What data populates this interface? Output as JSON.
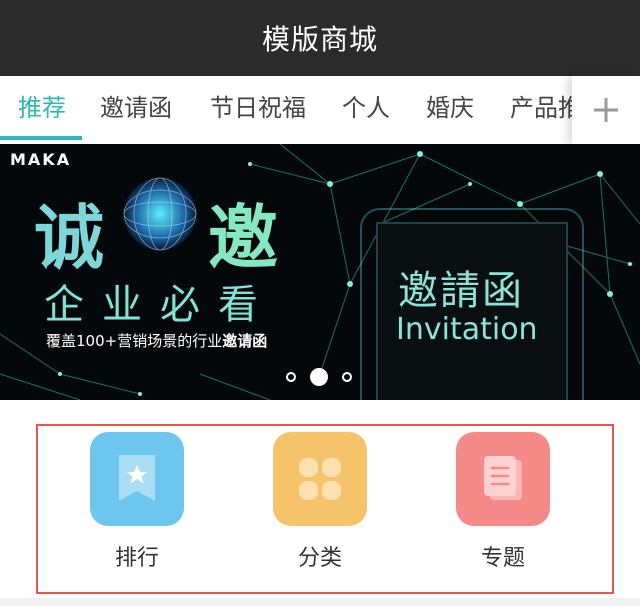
{
  "header": {
    "title": "模版商城"
  },
  "tabs": [
    {
      "label": "推荐",
      "active": true
    },
    {
      "label": "邀请函",
      "active": false
    },
    {
      "label": "节日祝福",
      "active": false
    },
    {
      "label": "个人",
      "active": false
    },
    {
      "label": "婚庆",
      "active": false
    },
    {
      "label": "产品推",
      "active": false
    }
  ],
  "tabs_add_icon": "plus-icon",
  "banner": {
    "logo": "MAKA",
    "title_left": "诚",
    "title_right": "邀",
    "subtitle": "企业必看",
    "desc_prefix": "覆盖100+营销场景的行业",
    "desc_bold": "邀请函",
    "invitation_cn": "邀請函",
    "invitation_en": "Invitation",
    "slides_total": 3,
    "slide_active": 2
  },
  "entries": [
    {
      "label": "排行",
      "icon": "bookmark-star-icon",
      "color": "#6cc6ee"
    },
    {
      "label": "分类",
      "icon": "grid-four-icon",
      "color": "#f5c46a"
    },
    {
      "label": "专题",
      "icon": "document-stack-icon",
      "color": "#f58a88"
    }
  ],
  "colors": {
    "accent": "#2fb8ad",
    "header_bg": "#2b2b2b",
    "highlight_border": "#e05a52"
  }
}
